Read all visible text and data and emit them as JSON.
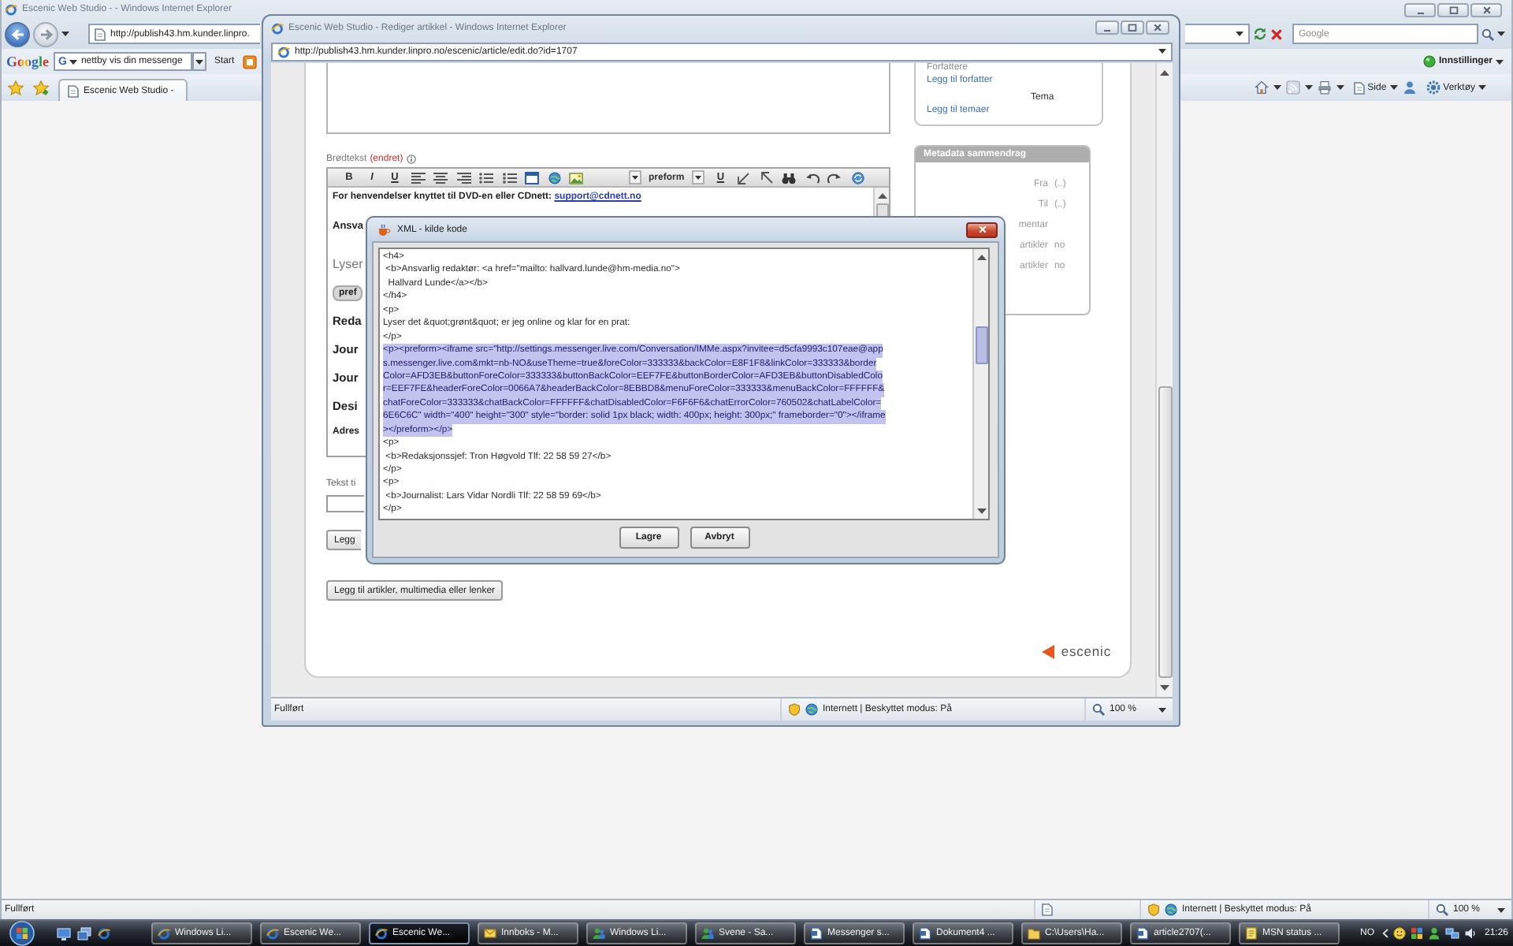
{
  "browser": {
    "title": "Escenic Web Studio - - Windows Internet Explorer",
    "address": "http://publish43.hm.kunder.linpro.",
    "search": {
      "placeholder": "Google"
    }
  },
  "google_toolbar": {
    "logo": "Google",
    "engine": "G",
    "query": "nettby vis din messenge",
    "start_button": "Start",
    "settings_menu": "Innstillinger"
  },
  "command_bar": {
    "tab": "Escenic Web Studio -",
    "page_menu": "Side",
    "tools_menu": "Verktøy"
  },
  "status_bar": {
    "status": "Fullført",
    "zone": "Internett | Beskyttet modus: På",
    "zoom": "100 %"
  },
  "popup_window": {
    "title": "Escenic Web Studio - Rediger artikkel - Windows Internet Explorer",
    "address": "http://publish43.hm.kunder.linpro.no/escenic/article/edit.do?id=1707",
    "body_text": {
      "label": "Brødtekst",
      "state": "(endret)",
      "style_buttons": [
        "B",
        "I",
        "U"
      ],
      "format": "preform",
      "extra_button": "U",
      "content": [
        {
          "kind": "lead",
          "text": "For henvendelser knyttet til DVD-en eller CDnett:",
          "link": "support@cdnett.no"
        },
        {
          "kind": "subheading",
          "text": "Ansva"
        },
        {
          "kind": "paragraph",
          "text": "Lyser"
        },
        {
          "kind": "tag",
          "text": "pref"
        },
        {
          "kind": "heading",
          "text": "Reda"
        },
        {
          "kind": "heading",
          "text": "Jour"
        },
        {
          "kind": "heading",
          "text": "Jour"
        },
        {
          "kind": "heading",
          "text": "Desi"
        },
        {
          "kind": "small_heading",
          "text": "Adres"
        }
      ]
    },
    "caption": {
      "label": "Tekst ti"
    },
    "buttons": [
      "Legg",
      "Legg til artikler, multimedia eller lenker"
    ],
    "authors": {
      "heading": "Forfattere",
      "link": "Legg til forfatter"
    },
    "topics": {
      "heading": "Tema",
      "link": "Legg til temaer"
    },
    "metadata": {
      "title": "Metadata sammendrag",
      "rows": [
        {
          "label": "Fra",
          "value": "(..)"
        },
        {
          "label": "Til",
          "value": "(..)"
        },
        {
          "label": "mentar"
        },
        {
          "label": "artikler",
          "value": "no"
        },
        {
          "label": "artikler",
          "value": "no"
        }
      ]
    },
    "logo": "escenic",
    "status_bar": {
      "status": "Fullført",
      "zone": "Internett | Beskyttet modus: På",
      "zoom": "100 %"
    }
  },
  "xml_dialog": {
    "title": "XML - kilde kode",
    "lines": [
      {
        "text": "<h4>",
        "selected": false
      },
      {
        "text": " <b>Ansvarlig redaktør: <a href=\"mailto: hallvard.lunde@hm-media.no\">",
        "selected": false
      },
      {
        "text": "  Hallvard Lunde</a></b>",
        "selected": false
      },
      {
        "text": "</h4>",
        "selected": false
      },
      {
        "text": "<p>",
        "selected": false
      },
      {
        "text": "Lyser det &quot;grønt&quot; er jeg online og klar for en prat:",
        "selected": false
      },
      {
        "text": "</p>",
        "selected": false
      },
      {
        "text": "<p><preform><iframe src=\"http://settings.messenger.live.com/Conversation/IMMe.aspx?invitee=d5cfa9993c107eae@app",
        "selected": true
      },
      {
        "text": "s.messenger.live.com&mkt=nb-NO&useTheme=true&foreColor=333333&backColor=E8F1F8&linkColor=333333&border",
        "selected": true
      },
      {
        "text": "Color=AFD3EB&buttonForeColor=333333&buttonBackColor=EEF7FE&buttonBorderColor=AFD3EB&buttonDisabledColo",
        "selected": true
      },
      {
        "text": "r=EEF7FE&headerForeColor=0066A7&headerBackColor=8EBBD8&menuForeColor=333333&menuBackColor=FFFFFF&",
        "selected": true
      },
      {
        "text": "chatForeColor=333333&chatBackColor=FFFFFF&chatDisabledColor=F6F6F6&chatErrorColor=760502&chatLabelColor=",
        "selected": true
      },
      {
        "text": "6E6C6C\" width=\"400\" height=\"300\" style=\"border: solid 1px black; width: 400px; height: 300px;\" frameborder=\"0\"></iframe",
        "selected": true
      },
      {
        "text": "></preform></p>",
        "selected": true
      },
      {
        "text": "<p>",
        "selected": false
      },
      {
        "text": " <b>Redaksjonssjef: Tron Høgvold Tlf: 22 58 59 27</b>",
        "selected": false
      },
      {
        "text": "</p>",
        "selected": false
      },
      {
        "text": "<p>",
        "selected": false
      },
      {
        "text": " <b>Journalist: Lars Vidar Nordli Tlf: 22 58 59 69</b>",
        "selected": false
      },
      {
        "text": "</p>",
        "selected": false
      }
    ],
    "buttons": [
      "Lagre",
      "Avbryt"
    ]
  },
  "taskbar": {
    "tasks": [
      {
        "kind": "browser",
        "label": "Windows Li...",
        "selected": false
      },
      {
        "kind": "browser",
        "label": "Escenic We...",
        "selected": false
      },
      {
        "kind": "browser",
        "label": "Escenic We...",
        "selected": true
      },
      {
        "kind": "mail",
        "label": "Innboks - M...",
        "selected": false
      },
      {
        "kind": "messenger",
        "label": "Windows Li...",
        "selected": false
      },
      {
        "kind": "messenger",
        "label": "Svene - Sa...",
        "selected": false
      },
      {
        "kind": "document",
        "label": "Messenger s...",
        "selected": false
      },
      {
        "kind": "document",
        "label": "Dokument4 ...",
        "selected": false
      },
      {
        "kind": "folder",
        "label": "C:\\Users\\Ha...",
        "selected": false
      },
      {
        "kind": "document",
        "label": "article2707(...",
        "selected": false
      },
      {
        "kind": "note",
        "label": "MSN status ...",
        "selected": false
      }
    ],
    "language": "NO",
    "clock": "21:26"
  }
}
